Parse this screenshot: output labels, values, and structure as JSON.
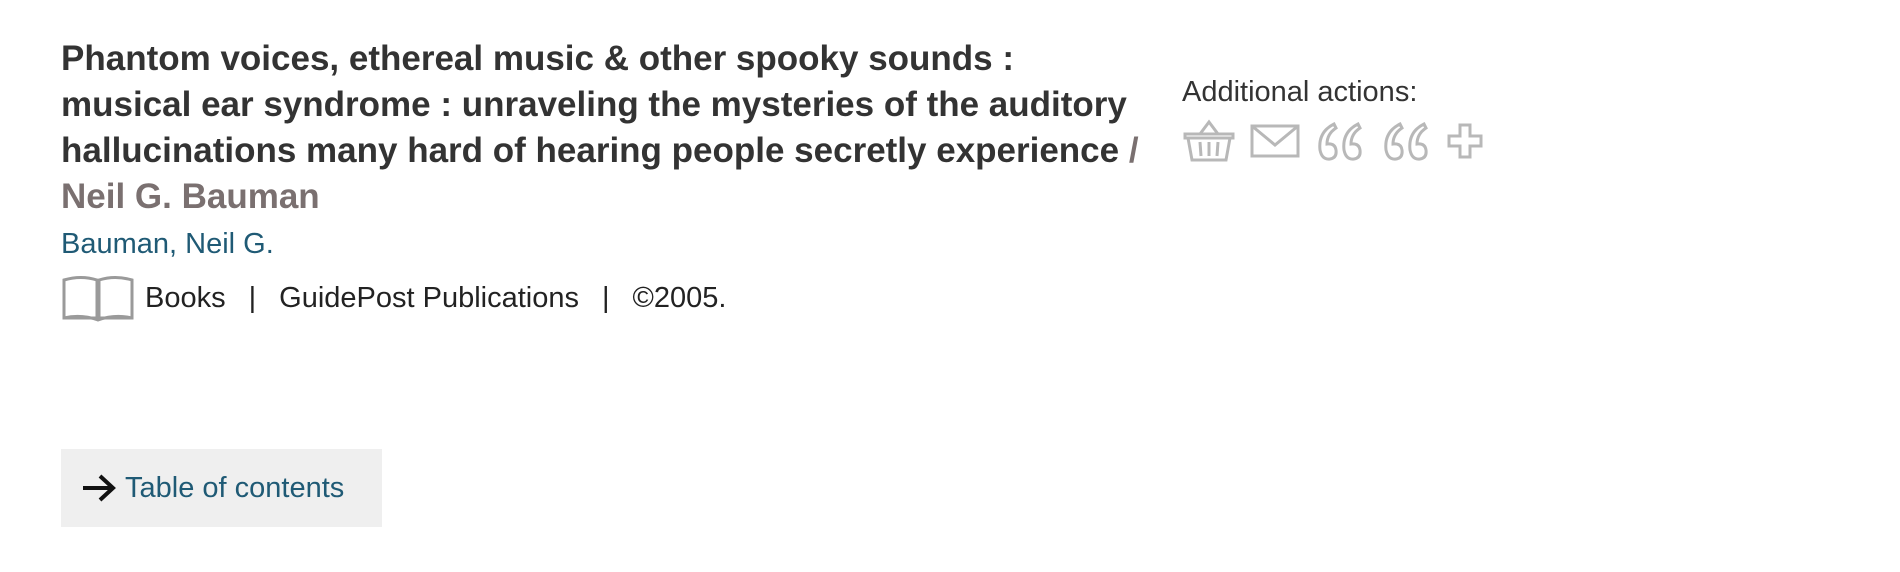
{
  "record": {
    "title": "Phantom voices, ethereal music & other spooky sounds : musical ear syndrome : unraveling the mysteries of the auditory hallucinations many hard of hearing people secretly experience",
    "responsibility": " / Neil G. Bauman",
    "author_link": "Bauman, Neil G.",
    "format": "Books",
    "publisher": "GuidePost Publications",
    "date": "©2005.",
    "separator": "|",
    "format_icon": "book-icon"
  },
  "actions": {
    "label": "Additional actions:",
    "icons": [
      "basket-icon",
      "email-icon",
      "cite-icon",
      "export-citation-icon",
      "add-icon"
    ],
    "icon_color": "#b8b8b8"
  },
  "toc": {
    "label": "Table of contents",
    "icon": "arrow-right-icon"
  },
  "colors": {
    "title": "#333333",
    "responsibility": "#7a7070",
    "link": "#1f5a75",
    "button_bg": "#efefef"
  }
}
